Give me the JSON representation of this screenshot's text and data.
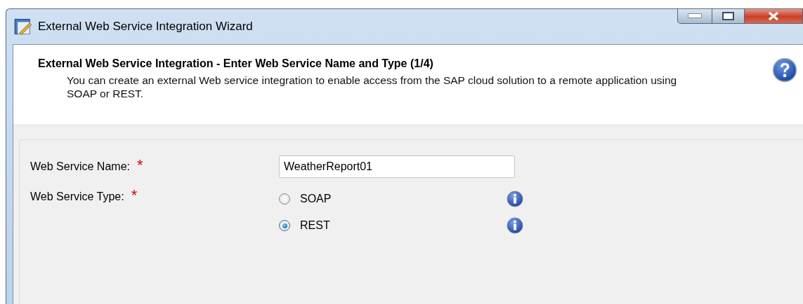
{
  "window": {
    "title": "External Web Service Integration Wizard"
  },
  "header": {
    "title": "External Web Service Integration - Enter Web Service Name and Type (1/4)",
    "description": "You can create an external Web service integration to enable access from the SAP cloud solution to a remote application using SOAP or REST."
  },
  "form": {
    "name_field": {
      "label": "Web Service Name:",
      "required_mark": "*",
      "value": "WeatherReport01"
    },
    "type_field": {
      "label": "Web Service Type:",
      "required_mark": "*",
      "options": [
        {
          "label": "SOAP",
          "selected": false
        },
        {
          "label": "REST",
          "selected": true
        }
      ]
    }
  }
}
